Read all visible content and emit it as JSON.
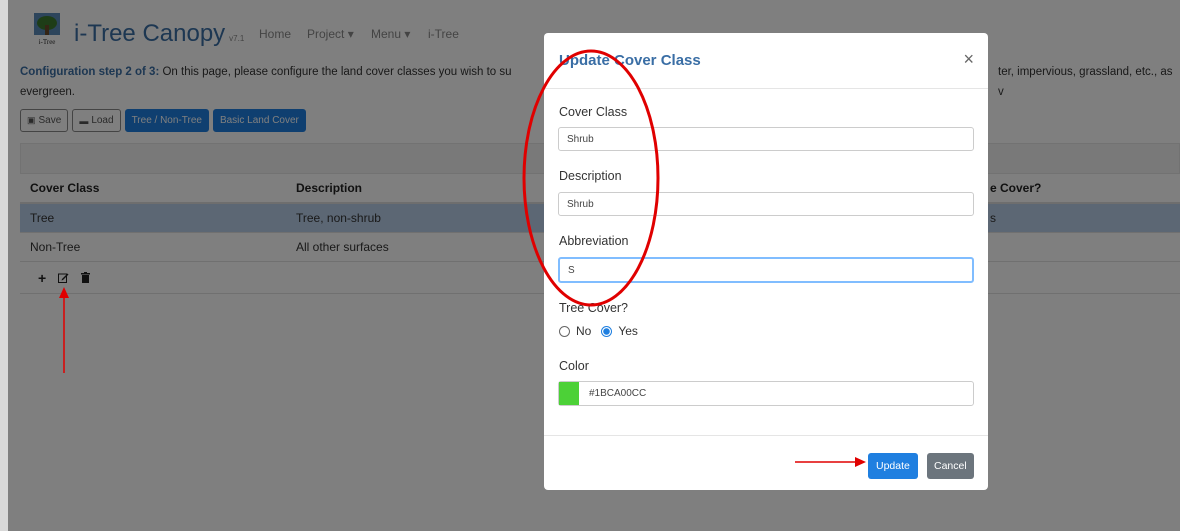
{
  "app": {
    "brand": "i-Tree Canopy",
    "version": "v7.1",
    "logo_caption": "i-Tree",
    "nav": [
      "Home",
      "Project",
      "Menu",
      "i-Tree"
    ]
  },
  "step": {
    "heading": "Configuration step 2 of 3:",
    "text": "On this page, please configure the land cover classes you wish to su",
    "text_right": "ter, impervious, grassland, etc., as v",
    "text_line2": "evergreen."
  },
  "buttons": {
    "save": "Save",
    "load": "Load",
    "tree_nontree": "Tree / Non-Tree",
    "basic_land_cover": "Basic Land Cover"
  },
  "table": {
    "headers": [
      "Cover Class",
      "Description",
      "e Cover?"
    ],
    "rows": [
      {
        "cover_class": "Tree",
        "description": "Tree, non-shrub",
        "tree_cover": "s"
      },
      {
        "cover_class": "Non-Tree",
        "description": "All other surfaces",
        "tree_cover": ""
      }
    ],
    "tools": [
      "+",
      "edit",
      "delete"
    ]
  },
  "modal": {
    "title": "Update Cover Class",
    "close": "×",
    "fields": {
      "cover_class_label": "Cover Class",
      "cover_class_value": "Shrub",
      "description_label": "Description",
      "description_value": "Shrub",
      "abbreviation_label": "Abbreviation",
      "abbreviation_value": "S",
      "tree_cover_label": "Tree Cover?",
      "no_label": "No",
      "yes_label": "Yes",
      "tree_cover_selected": "Yes",
      "color_label": "Color",
      "color_value": "#1BCA00CC",
      "swatch_color": "#4cd137"
    },
    "update_label": "Update",
    "cancel_label": "Cancel"
  },
  "annotation_color": "#e00000"
}
